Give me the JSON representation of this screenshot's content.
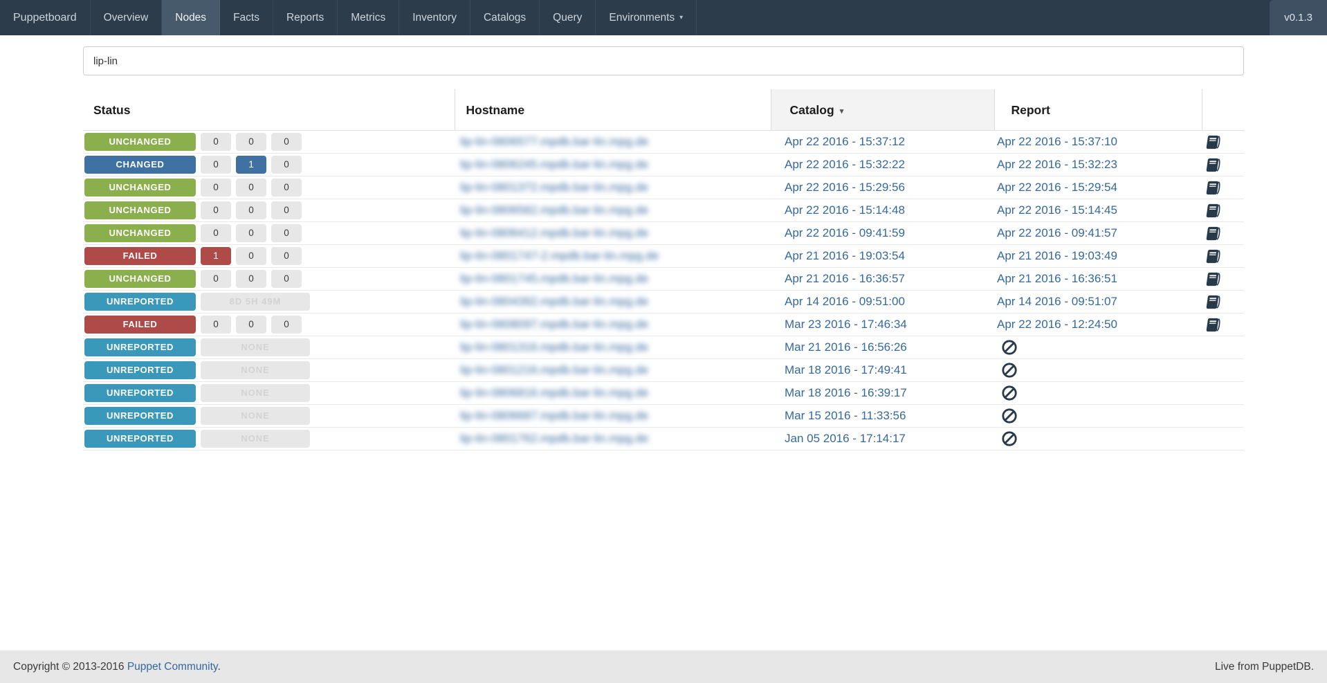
{
  "app": {
    "title": "Puppetboard"
  },
  "navbar": {
    "brand": "Puppetboard",
    "items": [
      {
        "label": "Overview"
      },
      {
        "label": "Nodes",
        "active": true
      },
      {
        "label": "Facts"
      },
      {
        "label": "Reports"
      },
      {
        "label": "Metrics"
      },
      {
        "label": "Inventory"
      },
      {
        "label": "Catalogs"
      },
      {
        "label": "Query"
      },
      {
        "label": "Environments",
        "caret": true
      }
    ],
    "version": "v0.1.3"
  },
  "icons": {
    "sort_desc": "▾",
    "nav_caret": "▾"
  },
  "search": {
    "value": "lip-lin"
  },
  "table": {
    "columns": [
      "Status",
      "Hostname",
      "Catalog",
      "Report"
    ],
    "sorted_column": "Catalog",
    "sort_direction": "desc",
    "hostnames_blurred": true,
    "rows": [
      {
        "status": "UNCHANGED",
        "variant": "unchanged",
        "pills": [
          {
            "value": "0"
          },
          {
            "value": "0"
          },
          {
            "value": "0"
          }
        ],
        "hostname": "lip-lin-0806577.mpdb.bar-lin.mpg.de",
        "catalog_time": "Apr 22 2016 - 15:37:12",
        "report_time": "Apr 22 2016 - 15:37:10",
        "icon": "book-icon"
      },
      {
        "status": "CHANGED",
        "variant": "changed",
        "pills": [
          {
            "value": "0"
          },
          {
            "value": "1",
            "highlight": "changed"
          },
          {
            "value": "0"
          }
        ],
        "hostname": "lip-lin-0806245.mpdb.bar-lin.mpg.de",
        "catalog_time": "Apr 22 2016 - 15:32:22",
        "report_time": "Apr 22 2016 - 15:32:23",
        "icon": "book-icon"
      },
      {
        "status": "UNCHANGED",
        "variant": "unchanged",
        "pills": [
          {
            "value": "0"
          },
          {
            "value": "0"
          },
          {
            "value": "0"
          }
        ],
        "hostname": "lip-lin-0801372.mpdb.bar-lin.mpg.de",
        "catalog_time": "Apr 22 2016 - 15:29:56",
        "report_time": "Apr 22 2016 - 15:29:54",
        "icon": "book-icon"
      },
      {
        "status": "UNCHANGED",
        "variant": "unchanged",
        "pills": [
          {
            "value": "0"
          },
          {
            "value": "0"
          },
          {
            "value": "0"
          }
        ],
        "hostname": "lip-lin-0806582.mpdb.bar-lin.mpg.de",
        "catalog_time": "Apr 22 2016 - 15:14:48",
        "report_time": "Apr 22 2016 - 15:14:45",
        "icon": "book-icon"
      },
      {
        "status": "UNCHANGED",
        "variant": "unchanged",
        "pills": [
          {
            "value": "0"
          },
          {
            "value": "0"
          },
          {
            "value": "0"
          }
        ],
        "hostname": "lip-lin-0806412.mpdb.bar-lin.mpg.de",
        "catalog_time": "Apr 22 2016 - 09:41:59",
        "report_time": "Apr 22 2016 - 09:41:57",
        "icon": "book-icon"
      },
      {
        "status": "FAILED",
        "variant": "failed",
        "pills": [
          {
            "value": "1",
            "highlight": "failed"
          },
          {
            "value": "0"
          },
          {
            "value": "0"
          }
        ],
        "hostname": "lip-lin-0801747-2.mpdb.bar-lin.mpg.de",
        "catalog_time": "Apr 21 2016 - 19:03:54",
        "report_time": "Apr 21 2016 - 19:03:49",
        "icon": "book-icon"
      },
      {
        "status": "UNCHANGED",
        "variant": "unchanged",
        "pills": [
          {
            "value": "0"
          },
          {
            "value": "0"
          },
          {
            "value": "0"
          }
        ],
        "hostname": "lip-lin-0801745.mpdb.bar-lin.mpg.de",
        "catalog_time": "Apr 21 2016 - 16:36:57",
        "report_time": "Apr 21 2016 - 16:36:51",
        "icon": "book-icon"
      },
      {
        "status": "UNREPORTED",
        "variant": "unreported",
        "wide_pill": "8D 5H 49M",
        "hostname": "lip-lin-0804392.mpdb.bar-lin.mpg.de",
        "catalog_time": "Apr 14 2016 - 09:51:00",
        "report_time": "Apr 14 2016 - 09:51:07",
        "icon": "book-icon"
      },
      {
        "status": "FAILED",
        "variant": "failed",
        "pills": [
          {
            "value": "0"
          },
          {
            "value": "0"
          },
          {
            "value": "0"
          }
        ],
        "hostname": "lip-lin-0808097.mpdb.bar-lin.mpg.de",
        "catalog_time": "Mar 23 2016 - 17:46:34",
        "report_time": "Apr 22 2016 - 12:24:50",
        "icon": "book-icon"
      },
      {
        "status": "UNREPORTED",
        "variant": "unreported",
        "wide_pill": "NONE",
        "hostname": "lip-lin-0801316.mpdb.bar-lin.mpg.de",
        "catalog_time": "Mar 21 2016 - 16:56:26",
        "report_time": null,
        "icon": "ban-icon"
      },
      {
        "status": "UNREPORTED",
        "variant": "unreported",
        "wide_pill": "NONE",
        "hostname": "lip-lin-0801216.mpdb.bar-lin.mpg.de",
        "catalog_time": "Mar 18 2016 - 17:49:41",
        "report_time": null,
        "icon": "ban-icon"
      },
      {
        "status": "UNREPORTED",
        "variant": "unreported",
        "wide_pill": "NONE",
        "hostname": "lip-lin-0806816.mpdb.bar-lin.mpg.de",
        "catalog_time": "Mar 18 2016 - 16:39:17",
        "report_time": null,
        "icon": "ban-icon"
      },
      {
        "status": "UNREPORTED",
        "variant": "unreported",
        "wide_pill": "NONE",
        "hostname": "lip-lin-0806687.mpdb.bar-lin.mpg.de",
        "catalog_time": "Mar 15 2016 - 11:33:56",
        "report_time": null,
        "icon": "ban-icon"
      },
      {
        "status": "UNREPORTED",
        "variant": "unreported",
        "wide_pill": "NONE",
        "hostname": "lip-lin-0801762.mpdb.bar-lin.mpg.de",
        "catalog_time": "Jan 05 2016 - 17:14:17",
        "report_time": null,
        "icon": "ban-icon"
      }
    ]
  },
  "footer": {
    "copyright_prefix": "Copyright © 2013-2016",
    "community_link": "Puppet Community",
    "suffix": ".",
    "right_text": "Live from PuppetDB."
  },
  "colors": {
    "navbar_bg": "#2d3c4b",
    "navbar_active_bg": "#475a6c",
    "link_blue": "#35689c",
    "status_unchanged": "#8baf4c",
    "status_changed": "#3f72a3",
    "status_failed": "#ae4a47",
    "status_unreported": "#3a99ba",
    "pill_bg": "#e7e7e7",
    "footer_bg": "#e7e7e7",
    "icon_dark": "#28394a"
  }
}
